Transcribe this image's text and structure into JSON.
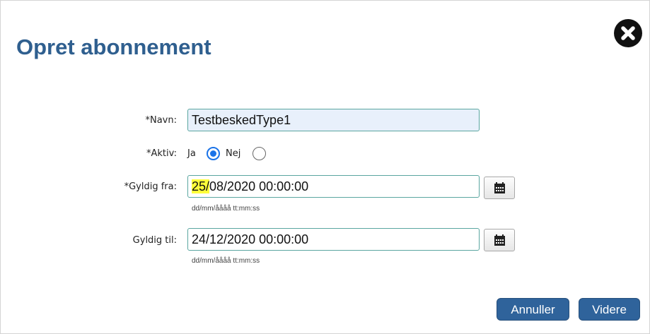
{
  "dialog": {
    "title": "Opret abonnement",
    "close_icon": "close-icon"
  },
  "form": {
    "navn": {
      "label": "*Navn:",
      "value": "TestbeskedType1"
    },
    "aktiv": {
      "label": "*Aktiv:",
      "options": [
        {
          "label": "Ja",
          "checked": true
        },
        {
          "label": "Nej",
          "checked": false
        }
      ]
    },
    "gyldig_fra": {
      "label": "*Gyldig fra:",
      "value_highlight": "25/",
      "value_rest": "08/2020 00:00:00",
      "hint": "dd/mm/åååå tt:mm:ss",
      "button_icon": "calendar-icon"
    },
    "gyldig_til": {
      "label": "Gyldig til:",
      "value": "24/12/2020 00:00:00",
      "hint": "dd/mm/åååå tt:mm:ss",
      "button_icon": "calendar-icon"
    }
  },
  "buttons": {
    "cancel": "Annuller",
    "next": "Videre"
  },
  "colors": {
    "title": "#2f5f8f",
    "button": "#2f639b",
    "radio_checked": "#1a73e8",
    "input_border": "#5aa6a0",
    "highlight": "#ffff3a"
  }
}
